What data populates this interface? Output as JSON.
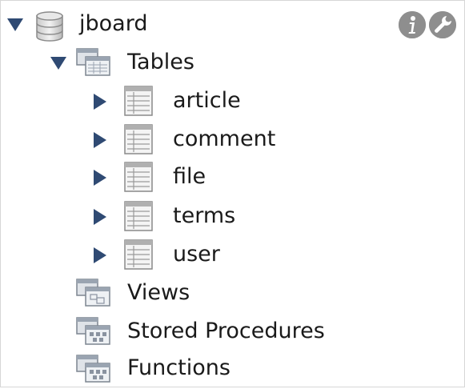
{
  "schema": {
    "name": "jboard",
    "actions": [
      {
        "icon": "info-icon"
      },
      {
        "icon": "wrench-icon"
      }
    ]
  },
  "tables_group": {
    "label": "Tables",
    "items": [
      {
        "label": "article"
      },
      {
        "label": "comment"
      },
      {
        "label": "file"
      },
      {
        "label": "terms"
      },
      {
        "label": "user"
      }
    ]
  },
  "views_group": {
    "label": "Views"
  },
  "procedures_group": {
    "label": "Stored Procedures"
  },
  "functions_group": {
    "label": "Functions"
  },
  "colors": {
    "arrow": "#2f4a73",
    "icon_gray": "#8e8e8e",
    "text": "#1a1a1a"
  }
}
